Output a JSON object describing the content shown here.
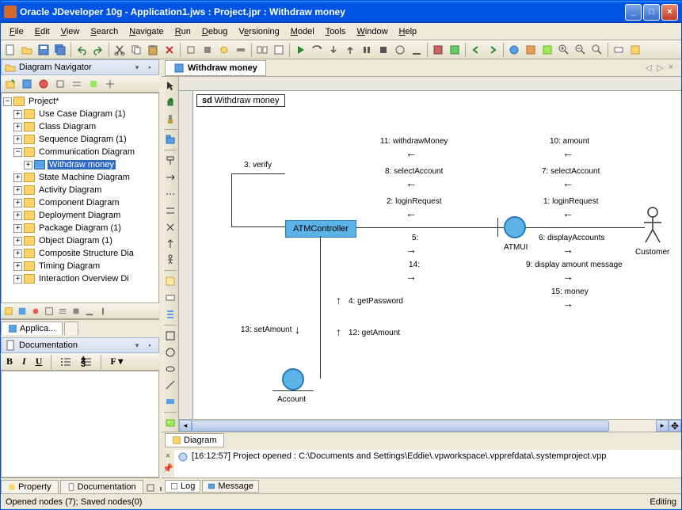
{
  "title": "Oracle JDeveloper 10g - Application1.jws : Project.jpr : Withdraw money",
  "menus": [
    "File",
    "Edit",
    "View",
    "Search",
    "Navigate",
    "Run",
    "Debug",
    "Versioning",
    "Model",
    "Tools",
    "Window",
    "Help"
  ],
  "menu_mnemonics": [
    "F",
    "E",
    "V",
    "S",
    "N",
    "R",
    "D",
    "e",
    "M",
    "T",
    "W",
    "H"
  ],
  "nav_panel": {
    "title": "Diagram Navigator",
    "root": "Project*",
    "items": [
      "Use Case Diagram (1)",
      "Class Diagram",
      "Sequence Diagram (1)",
      "Communication Diagram",
      "Withdraw money",
      "State Machine Diagram",
      "Activity Diagram",
      "Component Diagram",
      "Deployment Diagram",
      "Package Diagram (1)",
      "Object Diagram (1)",
      "Composite Structure Dia",
      "Timing Diagram",
      "Interaction Overview Di"
    ],
    "selected_index": 4,
    "tabs": [
      "Applica..."
    ]
  },
  "doc_panel": {
    "title": "Documentation"
  },
  "editor": {
    "tab": "Withdraw money",
    "frame_label_prefix": "sd",
    "frame_label": "Withdraw money",
    "elements": {
      "atm_controller": "ATMController",
      "atmui": "ATMUI",
      "customer": "Customer",
      "account": "Account"
    },
    "messages": {
      "m3": "3: verify",
      "m11": "11: withdrawMoney",
      "m8": "8: selectAccount",
      "m2": "2: loginRequest",
      "m5": "5:",
      "m14": "14:",
      "m10": "10: amount",
      "m7": "7: selectAccount",
      "m1": "1: loginRequest",
      "m6": "6: displayAccounts",
      "m9": "9: display amount message",
      "m15": "15: money",
      "m4": "4: getPassword",
      "m12": "12: getAmount",
      "m13": "13: setAmount"
    },
    "bottom_tab": "Diagram"
  },
  "log": {
    "text": "[16:12:57] Project opened : C:\\Documents and Settings\\Eddie\\.vpworkspace\\.vpprefdata\\.systemproject.vpp",
    "tabs": [
      "Log",
      "Message"
    ]
  },
  "bottom_left_tabs": [
    "Property",
    "Documentation"
  ],
  "status": {
    "left": "Opened nodes (7); Saved nodes(0)",
    "right": "Editing"
  }
}
